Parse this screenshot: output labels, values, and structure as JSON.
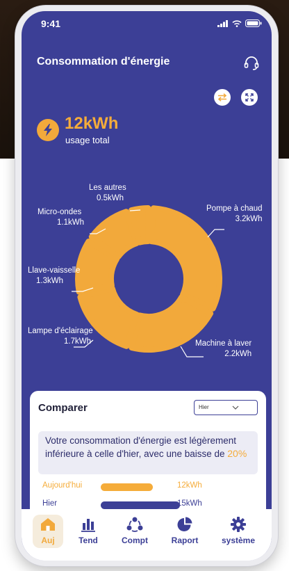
{
  "status": {
    "time": "9:41"
  },
  "header": {
    "title": "Consommation d'énergie"
  },
  "summary": {
    "value": "12kWh",
    "label": "usage total"
  },
  "breakdown": [
    {
      "name": "Pompe à chaud",
      "value": "3.2kWh",
      "kwh": 3.2
    },
    {
      "name": "Machine à laver",
      "value": "2.2kWh",
      "kwh": 2.2
    },
    {
      "name": "Lampe d'éclairage",
      "value": "1.7kWh",
      "kwh": 1.7
    },
    {
      "name": "Llave-vaisselle",
      "value": "1.3kWh",
      "kwh": 1.3
    },
    {
      "name": "Micro-ondes",
      "value": "1.1kWh",
      "kwh": 1.1
    },
    {
      "name": "Les autres",
      "value": "0.5kWh",
      "kwh": 0.5
    }
  ],
  "colors": {
    "accent": "#f2a93b",
    "background": "#3c3f96",
    "bar_today": "#f5ac3a",
    "bar_yesterday": "#3c3f96"
  },
  "compare": {
    "title": "Comparer",
    "period": "Hier",
    "message": "Votre consommation d'énergie est légèrement inférieure à celle d'hier, avec une baisse de",
    "percent": "20%",
    "rows": [
      {
        "name": "Aujourd'hui",
        "value": "12kWh",
        "kwh": 12
      },
      {
        "name": "Hier",
        "value": "15kWh",
        "kwh": 15
      }
    ]
  },
  "tabs": [
    {
      "label": "Auj",
      "icon": "home-icon",
      "active": true
    },
    {
      "label": "Tend",
      "icon": "bar-chart-icon",
      "active": false
    },
    {
      "label": "Compt",
      "icon": "users-icon",
      "active": false
    },
    {
      "label": "Raport",
      "icon": "pie-chart-icon",
      "active": false
    },
    {
      "label": "système",
      "icon": "gear-icon",
      "active": false
    }
  ]
}
